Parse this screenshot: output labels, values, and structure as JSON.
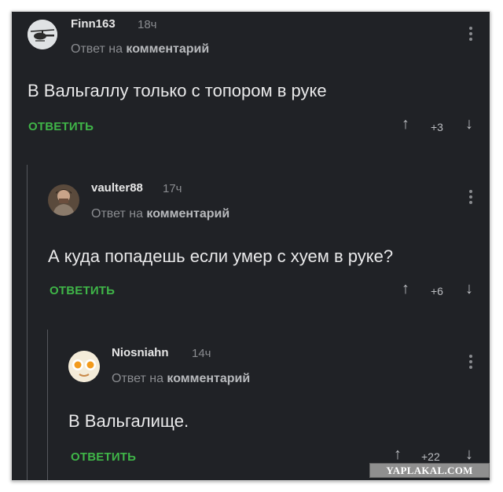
{
  "comments": [
    {
      "username": "Finn163",
      "time": "18ч",
      "reply_prefix": "Ответ на",
      "reply_target": "комментарий",
      "text": "В Вальгаллу только с топором в руке",
      "reply_label": "ОТВЕТИТЬ",
      "score": "+3",
      "avatar_icon": "helicopter-icon"
    },
    {
      "username": "vaulter88",
      "time": "17ч",
      "reply_prefix": "Ответ на",
      "reply_target": "комментарий",
      "text": "А куда попадешь если умер с хуем в руке?",
      "reply_label": "ОТВЕТИТЬ",
      "score": "+6",
      "avatar_icon": "person-avatar-icon"
    },
    {
      "username": "Niosniahn",
      "time": "14ч",
      "reply_prefix": "Ответ на",
      "reply_target": "комментарий",
      "text": "В Вальгалище.",
      "reply_label": "ОТВЕТИТЬ",
      "score": "+22",
      "avatar_icon": "eggs-icon"
    }
  ],
  "watermark": "YAPLAKAL.COM",
  "colors": {
    "background": "#202226",
    "accent_green": "#3fb548",
    "text": "#e9e9ea",
    "muted": "#8a8c90"
  }
}
